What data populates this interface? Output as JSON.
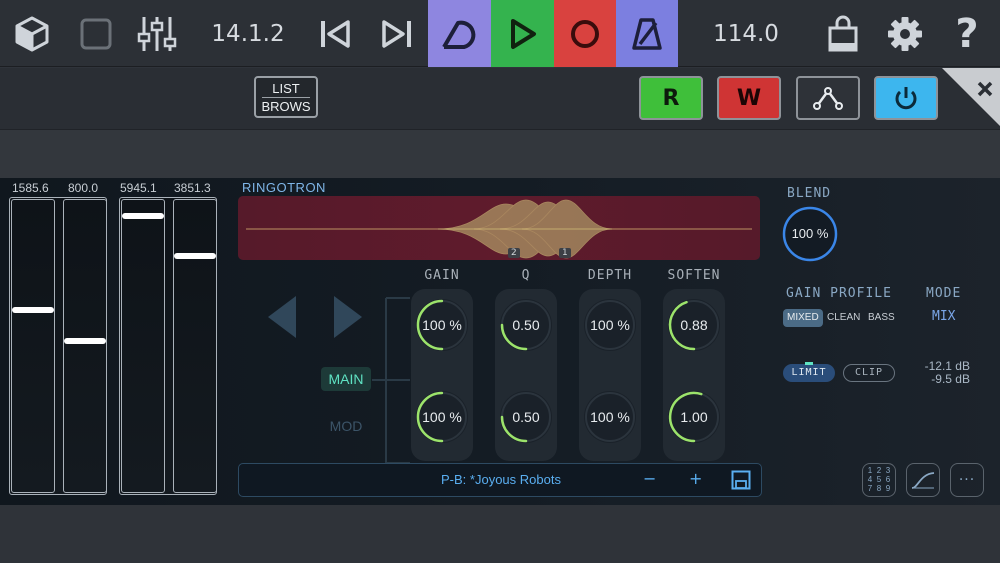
{
  "topbar": {
    "version": "14.1.2",
    "tempo": "114.0",
    "colors": {
      "loop": "#8e86e0",
      "play": "#34b34e",
      "record": "#d9423f",
      "metronome": "#7c7fe0"
    }
  },
  "browser_toggle": {
    "line1": "LIST",
    "line2": "BROWS"
  },
  "automation": {
    "read": "R",
    "write": "W"
  },
  "faders": {
    "labels": [
      "1585.6",
      "800.0",
      "5945.1",
      "3851.3"
    ],
    "levels": [
      0.63,
      0.52,
      0.96,
      0.82
    ]
  },
  "plugin": {
    "name": "RINGOTRON",
    "markers": [
      "2",
      "1"
    ],
    "columns": [
      "GAIN",
      "Q",
      "DEPTH",
      "SOFTEN"
    ],
    "main_tab": "MAIN",
    "mod_tab": "MOD",
    "knobs_main": [
      "100 %",
      "0.50",
      "100 %",
      "0.88"
    ],
    "knobs_mod": [
      "100 %",
      "0.50",
      "100 %",
      "1.00"
    ],
    "knob_levels_main": [
      0.5,
      0.25,
      0.0,
      0.45
    ],
    "knob_levels_mod": [
      0.5,
      0.25,
      0.0,
      0.55
    ],
    "preset": "P-B: *Joyous Robots",
    "preset_minus": "−",
    "preset_plus": "+"
  },
  "right": {
    "blend_label": "BLEND",
    "blend_value": "100 %",
    "gain_profile_label": "GAIN PROFILE",
    "mode_label": "MODE",
    "profiles": [
      "MIXED",
      "CLEAN",
      "BASS"
    ],
    "mode_value": "MIX",
    "limit": "LIMIT",
    "clip": "CLIP",
    "readout1": "-12.1 dB",
    "readout2": "-9.5 dB",
    "grid_digits": [
      "1",
      "2",
      "3",
      "4",
      "5",
      "6",
      "7",
      "8",
      "9"
    ]
  }
}
